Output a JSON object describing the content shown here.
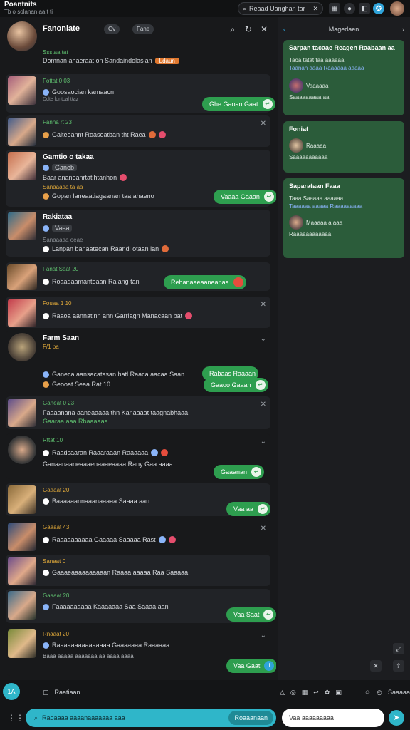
{
  "topbar": {
    "title": "Poantnits",
    "subtitle": "Tb o solanan aa t ti",
    "search": "Reaad Uanghan tar"
  },
  "left_head": {
    "name": "Fanoniate",
    "chips": [
      "Gv",
      "Fane"
    ],
    "sub": "Ssstaa tat",
    "line": "Domnan ahaeraat on Sandaindolasian",
    "tag": "Ldaun"
  },
  "cards": [
    {
      "meta": "Fottat 0 03",
      "title": "Goosaocian kamaacn",
      "row2": "Ddte lontcal ttaz",
      "btn": "Ghe Gaoan Gaat"
    },
    {
      "meta": "Fanna rt 23",
      "row": "Gaiteeannt Roaseatban  tht  Raea"
    },
    {
      "title": "Gamtio o takaa",
      "tag": "Ganeb",
      "row": "Baar ananeanrtatlhtanhon",
      "meta": "Sanaaaaa ta aa",
      "row2": "Gopan laneaatiagaanan taa ahaeno",
      "btn": "Vaaaa Gaaan"
    },
    {
      "title": "Rakiataa",
      "tag": "Vaea",
      "meta": "Sanaaaaa oeae",
      "row": "Lanpan banaatecan  Raandl otaan lan"
    },
    {
      "meta": "Fanat Saat 20",
      "row": "Roaadaamanteaan  Raiang tan",
      "btn": "Rehanaaeaaneanaa"
    },
    {
      "meta": "Fouaa 1 10",
      "row": "Raaoa aannatinn ann  Garriagn Manacaan bat"
    },
    {
      "title": "Farm Saan",
      "meta": "F/1 ba",
      "row": "Ganeca aansacatasan hatl  Raaca aacaa Saan",
      "row2": "Geooat Seaa Rat  10",
      "btn": "Rabaas Raaaan",
      "btn2": "Gaaoo Gaaan"
    },
    {
      "meta": "Ganeat 0 23",
      "row": "Faaaanana aaneaaaaa thn Kanaaaat taagnabhaaa",
      "row2": "Gaaraa aaa  Rbaaaaaa"
    },
    {
      "meta": "Rttat 10",
      "row": "Raadsaaran  Raaaraaan  Raaaaaa",
      "row2": "Ganaanaaneaaaenaaaeaaaa Rany Gaa aaaa",
      "btn": "Gaaanan"
    },
    {
      "meta": "Gaaaat 20",
      "row": "Baaaaaannaaanaaaaa Saaaa aan",
      "btn": "Vaa aa"
    },
    {
      "meta": "Gaaaat 43",
      "row": "Raaaaaaaaaa Gaaaaa Saaaaa Rast"
    },
    {
      "meta": "Sanaat 0",
      "row": "Gaaaeaaaaaaaaaan Raaaa aaaaa Raa Saaaaa"
    },
    {
      "meta": "Gaaaat 20",
      "row": "Faaaaaaaaaa Kaaaaaaa Saa Saaaa aan",
      "btn": "Vaa Saat"
    },
    {
      "meta": "Rnaaat 20",
      "row": "Raaaaaaaaaaaaaaa Gaaaaaaa Raaaaaa",
      "row2": "Baaa aaaaa aaaaaaa aa aaaa aaaa",
      "btn": "Vaa Gaat"
    }
  ],
  "right": {
    "header": "Magedaen",
    "boxes": [
      {
        "title": "Sarpan tacaae Reagen Raabaan aa",
        "l1": "Taoa tatat taa aaaaaa",
        "l2": "Taanan aaaa  Raaaaaa aaaaa",
        "l3": "Vaaaaaa",
        "l4": "Saaaaaaaaa aa"
      },
      {
        "title": "Foniat",
        "l1": "Raaaaa",
        "l2": "Saaaaaaaaaaa"
      },
      {
        "title": "Saparataan Faaa",
        "l1": "Taaa Saaaaa aaaaaa",
        "l2": "Taaaaaa aaaaa  Raaaaaaaaa",
        "l3": "Maaaaa a  aaa",
        "l4": "Raaaaaaaaaaaa"
      }
    ]
  },
  "bottom": {
    "composer": "Raatiaan",
    "ask": "Raoaaaa aaaanaaaaaaa aaa",
    "ask_btn": "Roaaanaan",
    "input": "Vaa aaaaaaaaa",
    "extra": "Saaaaa",
    "avatar": "1A"
  }
}
